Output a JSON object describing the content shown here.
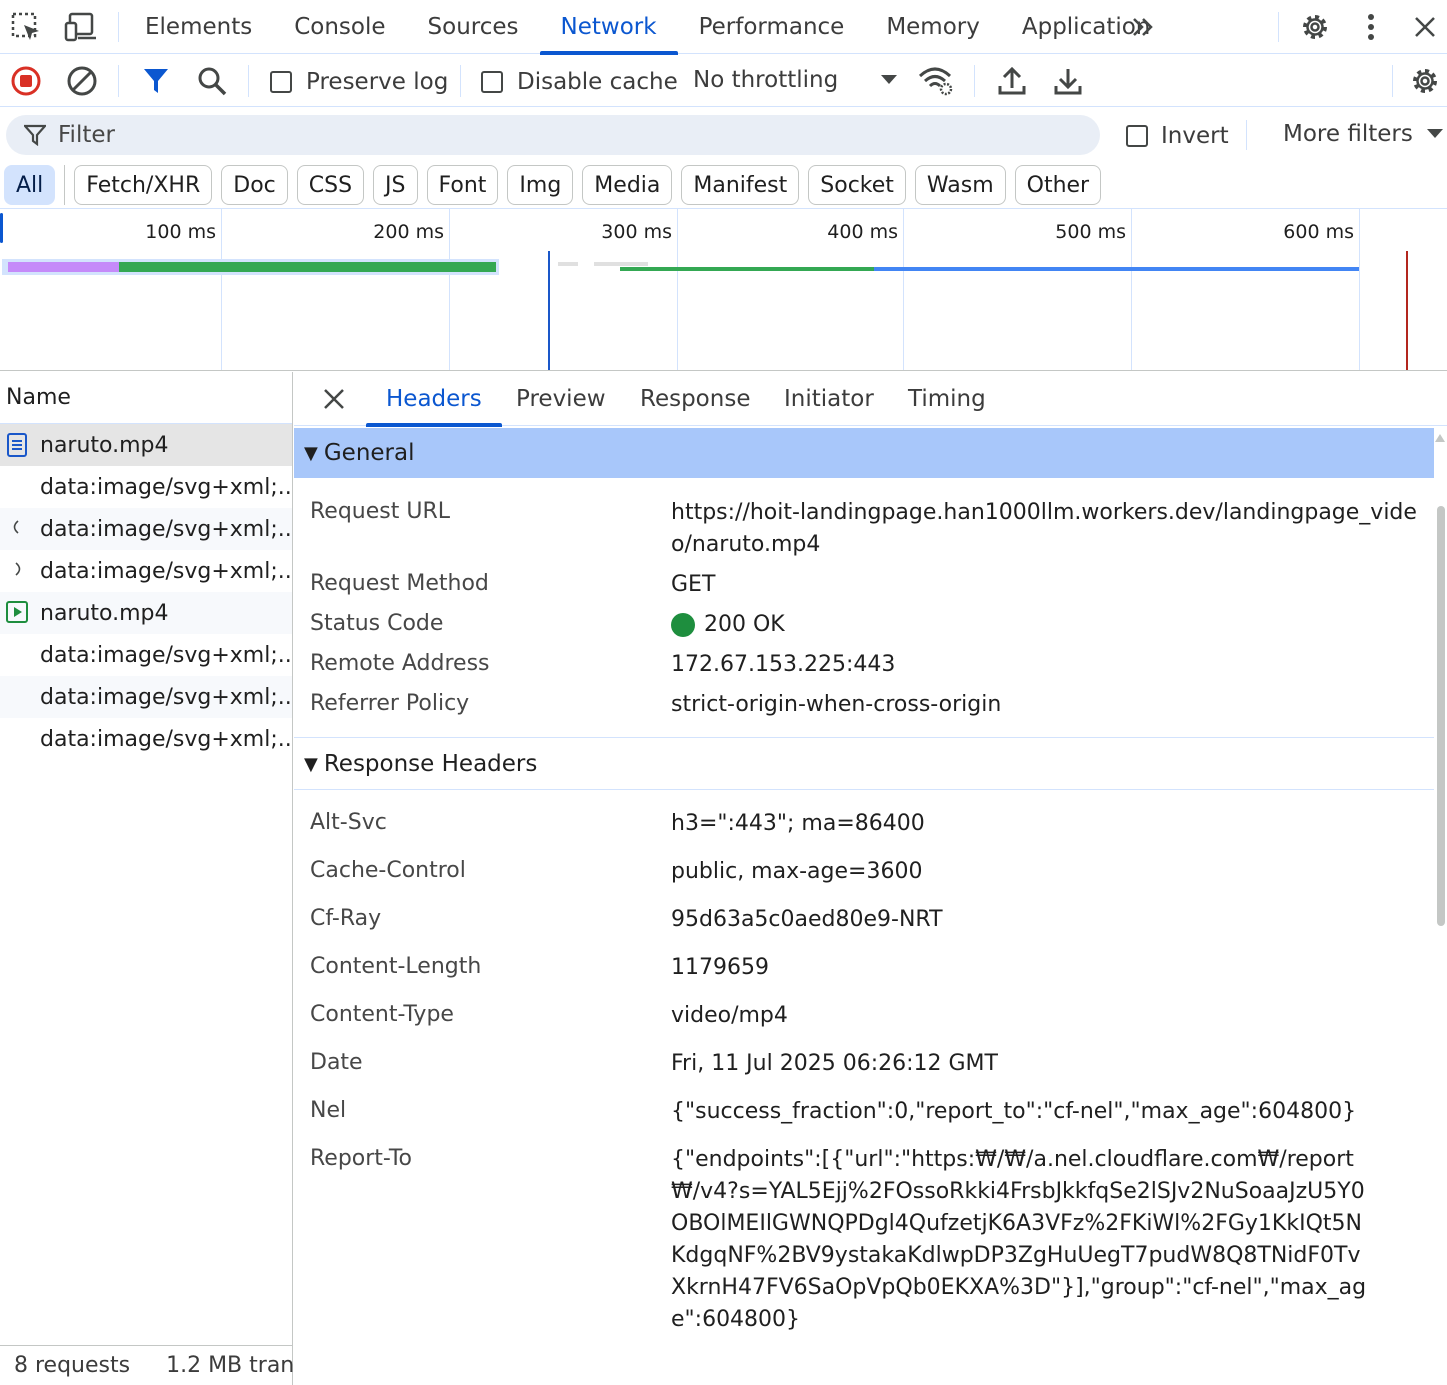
{
  "topbar": {
    "tabs": [
      "Elements",
      "Console",
      "Sources",
      "Network",
      "Performance",
      "Memory",
      "Application"
    ],
    "active_tab": "Network",
    "more_label": "»"
  },
  "toolbar": {
    "preserve_log": "Preserve log",
    "disable_cache": "Disable cache",
    "throttling": "No throttling"
  },
  "filter": {
    "placeholder": "Filter",
    "invert": "Invert",
    "more_filters": "More filters"
  },
  "chips": [
    "All",
    "Fetch/XHR",
    "Doc",
    "CSS",
    "JS",
    "Font",
    "Img",
    "Media",
    "Manifest",
    "Socket",
    "Wasm",
    "Other"
  ],
  "overview": {
    "ticks": [
      "100 ms",
      "200 ms",
      "300 ms",
      "400 ms",
      "500 ms",
      "600 ms"
    ]
  },
  "requests": {
    "header": "Name",
    "rows": [
      {
        "name": "naruto.mp4",
        "icon": "document-icon"
      },
      {
        "name": "data:image/svg+xml;...",
        "icon": ""
      },
      {
        "name": "data:image/svg+xml;...",
        "icon": "spinner-icon"
      },
      {
        "name": "data:image/svg+xml;...",
        "icon": "spinner-icon"
      },
      {
        "name": "naruto.mp4",
        "icon": "media-icon"
      },
      {
        "name": "data:image/svg+xml;...",
        "icon": ""
      },
      {
        "name": "data:image/svg+xml;...",
        "icon": ""
      },
      {
        "name": "data:image/svg+xml;...",
        "icon": ""
      }
    ],
    "status_count": "8 requests",
    "status_size": "1.2 MB tran"
  },
  "detail": {
    "tabs": [
      "Headers",
      "Preview",
      "Response",
      "Initiator",
      "Timing"
    ],
    "active_tab": "Headers",
    "general_title": "General",
    "general": {
      "request_url_key": "Request URL",
      "request_url": "https://hoit-landingpage.han1000llm.workers.dev/landingpage_video/naruto.mp4",
      "method_key": "Request Method",
      "method": "GET",
      "status_key": "Status Code",
      "status": "200 OK",
      "remote_key": "Remote Address",
      "remote": "172.67.153.225:443",
      "referrer_key": "Referrer Policy",
      "referrer": "strict-origin-when-cross-origin"
    },
    "response_title": "Response Headers",
    "response_headers": [
      {
        "key": "Alt-Svc",
        "value": "h3=\":443\"; ma=86400"
      },
      {
        "key": "Cache-Control",
        "value": "public, max-age=3600"
      },
      {
        "key": "Cf-Ray",
        "value": "95d63a5c0aed80e9-NRT"
      },
      {
        "key": "Content-Length",
        "value": "1179659"
      },
      {
        "key": "Content-Type",
        "value": "video/mp4"
      },
      {
        "key": "Date",
        "value": "Fri, 11 Jul 2025 06:26:12 GMT"
      },
      {
        "key": "Nel",
        "value": "{\"success_fraction\":0,\"report_to\":\"cf-nel\",\"max_age\":604800}"
      },
      {
        "key": "Report-To",
        "value": "{\"endpoints\":[{\"url\":\"https:₩/₩/a.nel.cloudflare.com₩/report₩/v4?s=YAL5Ejj%2FOssoRkki4FrsbJkkfqSe2lSJv2NuSoaaJzU5Y0OBOlMEIlGWNQPDgl4QufzetjK6A3VFz%2FKiWl%2FGy1KkIQt5NKdgqNF%2BV9ystakaKdlwpDP3ZgHuUegT7pudW8Q8TNidF0TvXkrnH47FV6SaOpVpQb0EKXA%3D\"}],\"group\":\"cf-nel\",\"max_age\":604800}"
      }
    ]
  },
  "colors": {
    "accent": "#0b57d0",
    "status_ok": "#1e8e3e",
    "record": "#d93025"
  }
}
